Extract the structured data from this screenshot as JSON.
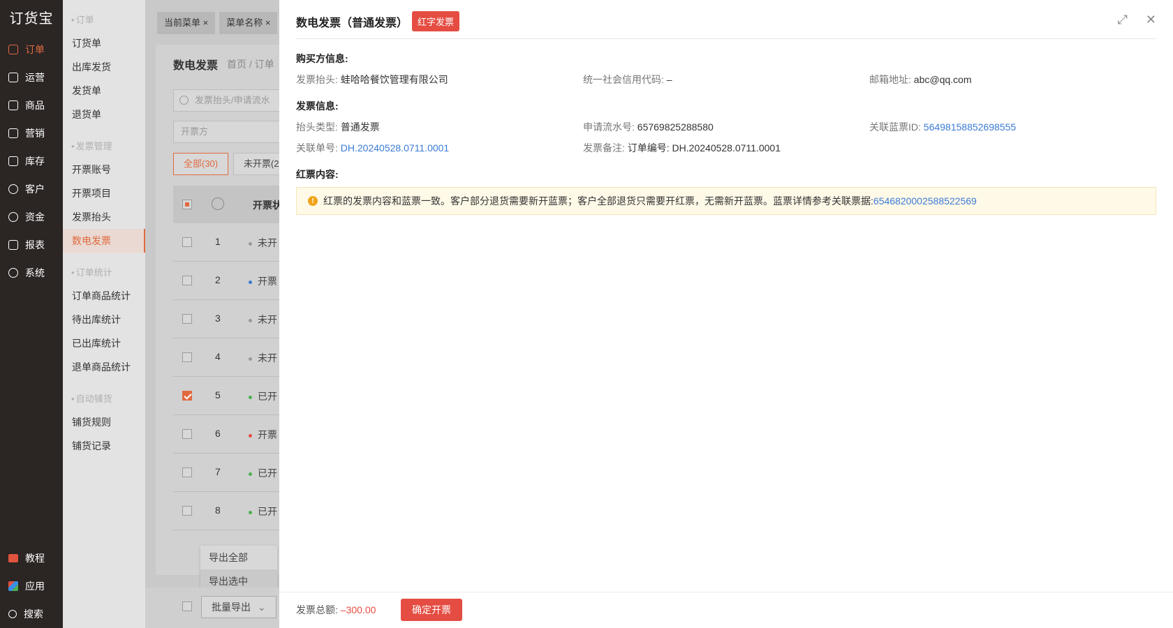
{
  "nav": {
    "logo": "订货宝",
    "items": [
      {
        "label": "订单",
        "active": true
      },
      {
        "label": "运营"
      },
      {
        "label": "商品"
      },
      {
        "label": "营销"
      },
      {
        "label": "库存"
      },
      {
        "label": "客户"
      },
      {
        "label": "资金"
      },
      {
        "label": "报表"
      },
      {
        "label": "系统"
      }
    ],
    "bottom": [
      {
        "label": "教程"
      },
      {
        "label": "应用"
      },
      {
        "label": "搜索"
      }
    ]
  },
  "submenu": {
    "group1": "订单",
    "g1": [
      "订货单",
      "出库发货",
      "发货单",
      "退货单"
    ],
    "group2": "发票管理",
    "g2": [
      "开票账号",
      "开票项目",
      "发票抬头",
      "数电发票"
    ],
    "group3": "订单统计",
    "g3": [
      "订单商品统计",
      "待出库统计",
      "已出库统计",
      "退单商品统计"
    ],
    "group4": "自动铺货",
    "g4": [
      "铺货规则",
      "铺货记录"
    ]
  },
  "bg": {
    "tabs": [
      "当前菜单",
      "菜单名称"
    ],
    "title": "数电发票",
    "crumb": "首页 / 订单",
    "search_placeholder": "发票抬头/申请流水",
    "issuer_placeholder": "开票方",
    "seg_all": "全部(30)",
    "seg_un": "未开票(2",
    "col_status": "开票状",
    "rows": [
      {
        "n": "1",
        "s": "未开"
      },
      {
        "n": "2",
        "s": "开票"
      },
      {
        "n": "3",
        "s": "未开"
      },
      {
        "n": "4",
        "s": "未开"
      },
      {
        "n": "5",
        "s": "已开"
      },
      {
        "n": "6",
        "s": "开票"
      },
      {
        "n": "7",
        "s": "已开"
      },
      {
        "n": "8",
        "s": "已开"
      }
    ],
    "export_all": "导出全部",
    "export_sel": "导出选中",
    "bulk_export": "批量导出"
  },
  "drawer": {
    "title": "数电发票（普通发票）",
    "badge": "红字发票",
    "buyer_section": "购买方信息:",
    "buyer_head_k": "发票抬头:",
    "buyer_head_v": "蛙哈哈餐饮管理有限公司",
    "credit_k": "统一社会信用代码:",
    "credit_v": "–",
    "email_k": "邮箱地址:",
    "email_v": "abc@qq.com",
    "invoice_section": "发票信息:",
    "type_k": "抬头类型:",
    "type_v": "普通发票",
    "serial_k": "申请流水号:",
    "serial_v": "65769825288580",
    "blue_id_k": "关联蓝票ID:",
    "blue_id_v": "56498158852698555",
    "order_k": "关联单号:",
    "order_v": "DH.20240528.0711.0001",
    "remark_k": "发票备注:",
    "remark_v": "订单编号: DH.20240528.0711.0001",
    "red_section": "红票内容:",
    "notice_text": "红票的发票内容和蓝票一致。客户部分退货需要新开蓝票；客户全部退货只需要开红票，无需新开蓝票。蓝票详情参考关联票据:",
    "notice_link": "6546820002588522569",
    "total_k": "发票总额:",
    "total_v": "–300.00",
    "confirm": "确定开票"
  },
  "colors": {
    "accent": "#e06a3f",
    "danger": "#e54d42",
    "link": "#3a7bd5"
  }
}
